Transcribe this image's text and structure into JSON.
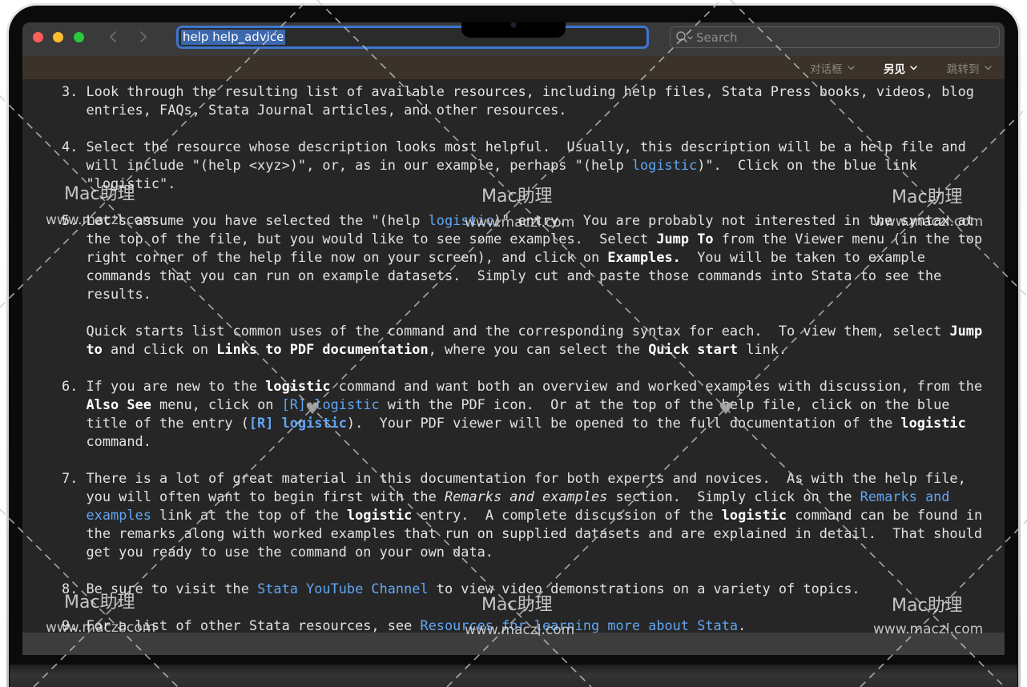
{
  "window": {
    "address": "help help_advice",
    "search_placeholder": "Search",
    "back_icon": "chevron-left-icon",
    "forward_icon": "chevron-right-icon",
    "search_icon": "magnifier-icon"
  },
  "toolbar": {
    "dialog_label": "对话框",
    "also_see_label": "另见",
    "jump_to_label": "跳转到"
  },
  "content": {
    "lines": [
      [
        {
          "t": "3. Look through the resulting list of available resources, including help files, Stata Press books, videos, blog"
        }
      ],
      [
        {
          "t": "   entries, FAQs, Stata Journal articles, and other resources."
        }
      ],
      [],
      [
        {
          "t": "4. Select the resource whose description looks most helpful.  Usually, this description will be a help file and"
        }
      ],
      [
        {
          "t": "   will include \"(help <xyz>)\", or, as in our example, perhaps \"(help "
        },
        {
          "t": "logistic",
          "link": true
        },
        {
          "t": ")\".  Click on the blue link"
        }
      ],
      [
        {
          "t": "   \"logistic\"."
        }
      ],
      [],
      [
        {
          "t": "5. Let's assume you have selected the \"(help "
        },
        {
          "t": "logistic",
          "link": true
        },
        {
          "t": ")\" entry.  You are probably not interested in the syntax at"
        }
      ],
      [
        {
          "t": "   the top of the file, but you would like to see some examples.  Select "
        },
        {
          "t": "Jump To",
          "bold": true
        },
        {
          "t": " from the Viewer menu (in the top"
        }
      ],
      [
        {
          "t": "   right corner of the help file now on your screen), and click on "
        },
        {
          "t": "Examples.",
          "bold": true
        },
        {
          "t": "  You will be taken to example"
        }
      ],
      [
        {
          "t": "   commands that you can run on example datasets.  Simply cut and paste those commands into Stata to see the"
        }
      ],
      [
        {
          "t": "   results."
        }
      ],
      [],
      [
        {
          "t": "   Quick starts list common uses of the command and the corresponding syntax for each.  To view them, select "
        },
        {
          "t": "Jump",
          "bold": true
        }
      ],
      [
        {
          "t": "   "
        },
        {
          "t": "to",
          "bold": true
        },
        {
          "t": " and click on "
        },
        {
          "t": "Links to PDF documentation",
          "bold": true
        },
        {
          "t": ", where you can select the "
        },
        {
          "t": "Quick start",
          "bold": true
        },
        {
          "t": " link."
        }
      ],
      [],
      [
        {
          "t": "6. If you are new to the "
        },
        {
          "t": "logistic",
          "bold": true
        },
        {
          "t": " command and want both an overview and worked examples with discussion, from the"
        }
      ],
      [
        {
          "t": "   "
        },
        {
          "t": "Also See",
          "bold": true
        },
        {
          "t": " menu, click on "
        },
        {
          "t": "[R] logistic",
          "link": true
        },
        {
          "t": " with the PDF icon.  Or at the top of the help file, click on the blue"
        }
      ],
      [
        {
          "t": "   title of the entry ("
        },
        {
          "t": "[R] logistic",
          "link": true,
          "bold": true
        },
        {
          "t": ").  Your PDF viewer will be opened to the full documentation of the "
        },
        {
          "t": "logistic",
          "bold": true
        }
      ],
      [
        {
          "t": "   command."
        }
      ],
      [],
      [
        {
          "t": "7. There is a lot of great material in this documentation for both experts and novices.  As with the help file,"
        }
      ],
      [
        {
          "t": "   you will often want to begin first with the "
        },
        {
          "t": "Remarks and examples",
          "italic": true
        },
        {
          "t": " section.  Simply click on the "
        },
        {
          "t": "Remarks and",
          "link": true
        }
      ],
      [
        {
          "t": "   "
        },
        {
          "t": "examples",
          "link": true
        },
        {
          "t": " link at the top of the "
        },
        {
          "t": "logistic",
          "bold": true
        },
        {
          "t": " entry.  A complete discussion of the "
        },
        {
          "t": "logistic",
          "bold": true
        },
        {
          "t": " command can be found in"
        }
      ],
      [
        {
          "t": "   the remarks along with worked examples that run on supplied datasets and are explained in detail.  That should"
        }
      ],
      [
        {
          "t": "   get you ready to use the command on your own data."
        }
      ],
      [],
      [
        {
          "t": "8. Be sure to visit the "
        },
        {
          "t": "Stata YouTube Channel",
          "link": true
        },
        {
          "t": " to view video demonstrations on a variety of topics."
        }
      ],
      [],
      [
        {
          "t": "9. For a list of other Stata resources, see "
        },
        {
          "t": "Resources for learning more about Stata",
          "link": true
        },
        {
          "t": "."
        }
      ]
    ]
  },
  "watermark": {
    "brand": "Mac助理",
    "url": "www.maczl.com",
    "icon": "heart-icon"
  },
  "colors": {
    "accent": "#3d76cf",
    "selection": "#3b67ad",
    "link": "#62a5f3",
    "text": "#e2e2e2",
    "bold": "#ffffff",
    "background": "#262626",
    "close": "#ff5f57",
    "minimize": "#febc2e",
    "zoom": "#28c840"
  }
}
